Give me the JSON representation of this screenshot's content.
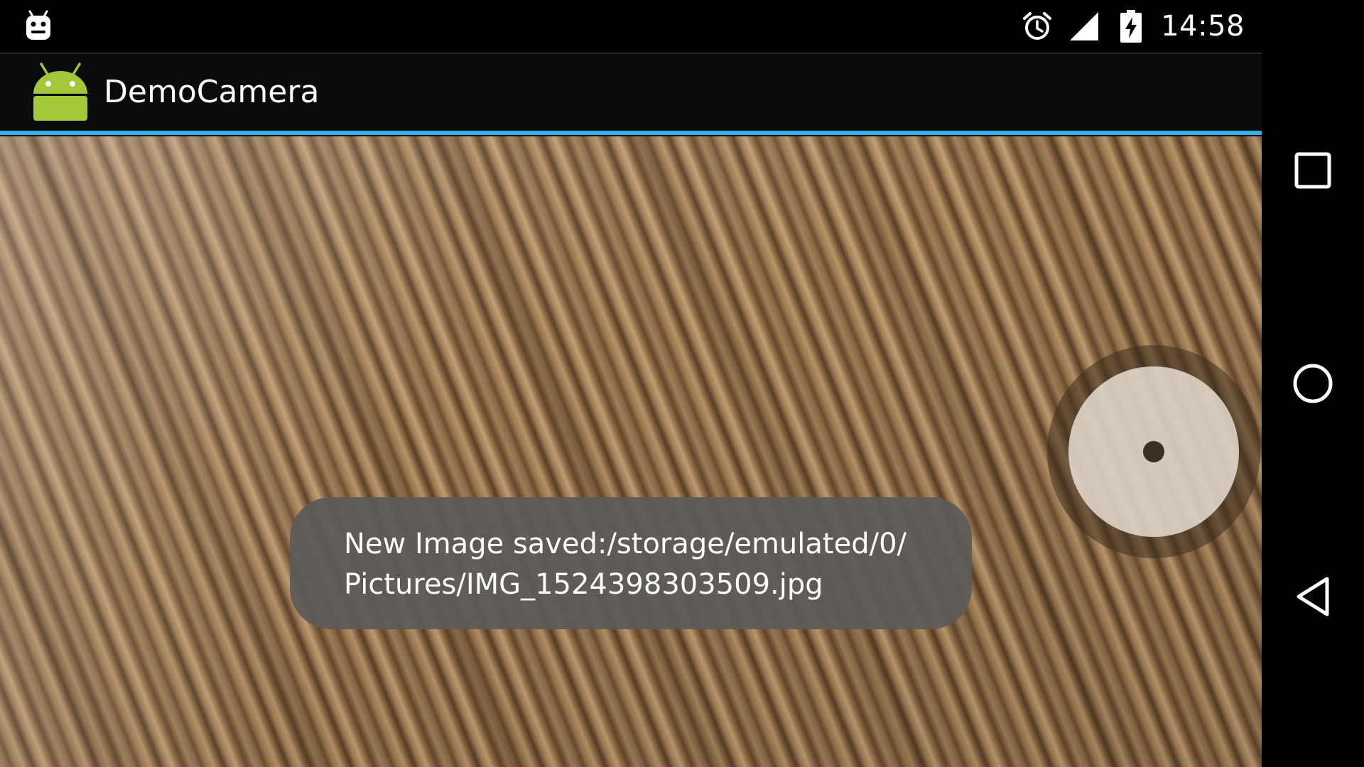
{
  "status_bar": {
    "time": "14:58",
    "icons": [
      "android-debug-icon",
      "alarm-icon",
      "signal-icon",
      "battery-charging-icon"
    ]
  },
  "action_bar": {
    "title": "DemoCamera",
    "app_icon": "android-robot-icon",
    "accent_color": "#33b5e5"
  },
  "camera": {
    "shutter_icon": "shutter-button"
  },
  "toast": {
    "line1": "New Image saved:/storage/emulated/0/",
    "line2": "Pictures/IMG_1524398303509.jpg"
  },
  "nav_bar": {
    "buttons": [
      "recent-apps-icon",
      "home-icon",
      "back-icon"
    ]
  }
}
